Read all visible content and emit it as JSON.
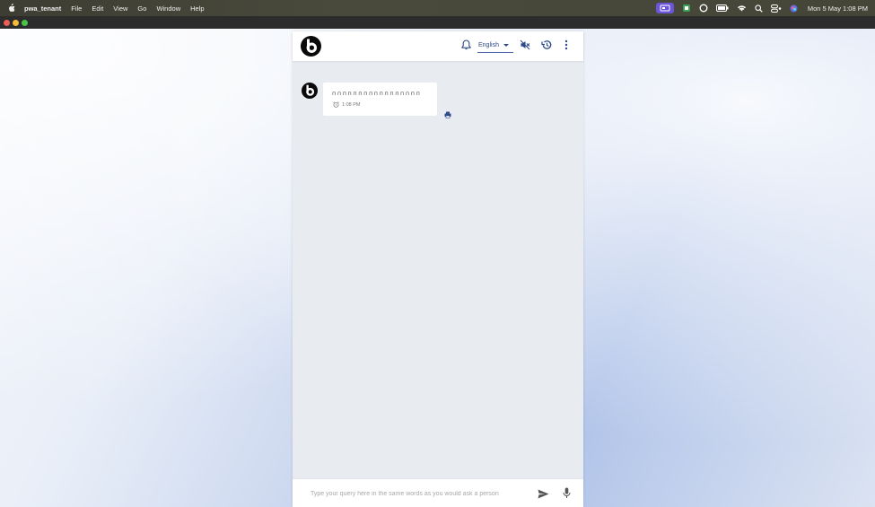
{
  "menubar": {
    "app_name": "pwa_tenant",
    "items": [
      "File",
      "Edit",
      "View",
      "Go",
      "Window",
      "Help"
    ],
    "clock": "Mon 5 May  1:08 PM"
  },
  "header": {
    "language": "English",
    "icons": [
      "bell-icon",
      "volume-off-icon",
      "history-icon",
      "more-vert-icon"
    ]
  },
  "messages": [
    {
      "text": "ппппппппппппппппп",
      "time": "1:08 PM"
    }
  ],
  "input": {
    "placeholder": "Type your query here in the same words as you would ask a person"
  },
  "colors": {
    "accent": "#2d4a8a",
    "panel_bg": "#e8ebf0",
    "menubar_bg": "#464638"
  }
}
